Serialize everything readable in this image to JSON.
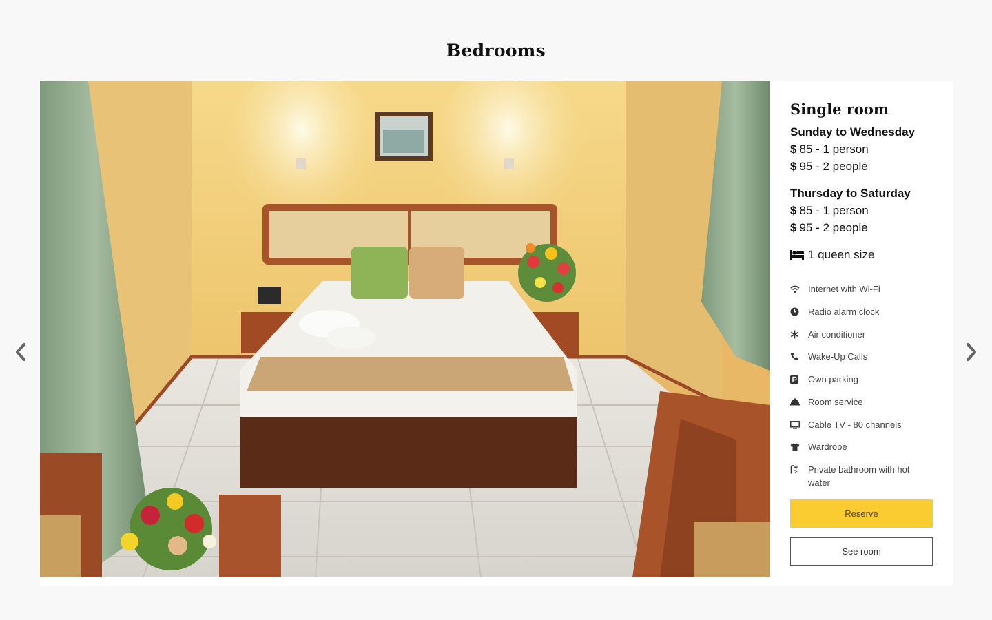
{
  "page": {
    "title": "Bedrooms"
  },
  "room": {
    "name": "Single room",
    "rates": [
      {
        "period": "Sunday to Wednesday",
        "prices": [
          {
            "currency": "$",
            "text": "85 - 1 person"
          },
          {
            "currency": "$",
            "text": "95 - 2 people"
          }
        ]
      },
      {
        "period": "Thursday to Saturday",
        "prices": [
          {
            "currency": "$",
            "text": "85 - 1 person"
          },
          {
            "currency": "$",
            "text": "95 - 2 people"
          }
        ]
      }
    ],
    "bed": {
      "icon": "bed-icon",
      "text": "1 queen size"
    },
    "amenities": [
      {
        "icon": "wifi-icon",
        "label": "Internet with Wi-Fi"
      },
      {
        "icon": "clock-icon",
        "label": "Radio alarm clock"
      },
      {
        "icon": "snowflake-icon",
        "label": "Air conditioner"
      },
      {
        "icon": "phone-icon",
        "label": "Wake-Up Calls"
      },
      {
        "icon": "parking-icon",
        "label": "Own parking"
      },
      {
        "icon": "room-service-icon",
        "label": "Room service"
      },
      {
        "icon": "tv-icon",
        "label": "Cable TV - 80 channels"
      },
      {
        "icon": "shirt-icon",
        "label": "Wardrobe"
      },
      {
        "icon": "shower-icon",
        "label": "Private bathroom with hot water"
      }
    ],
    "buttons": {
      "reserve": "Reserve",
      "see_room": "See room"
    }
  },
  "colors": {
    "accent": "#fbcb32",
    "background": "#f8f8f8",
    "card": "#ffffff"
  }
}
